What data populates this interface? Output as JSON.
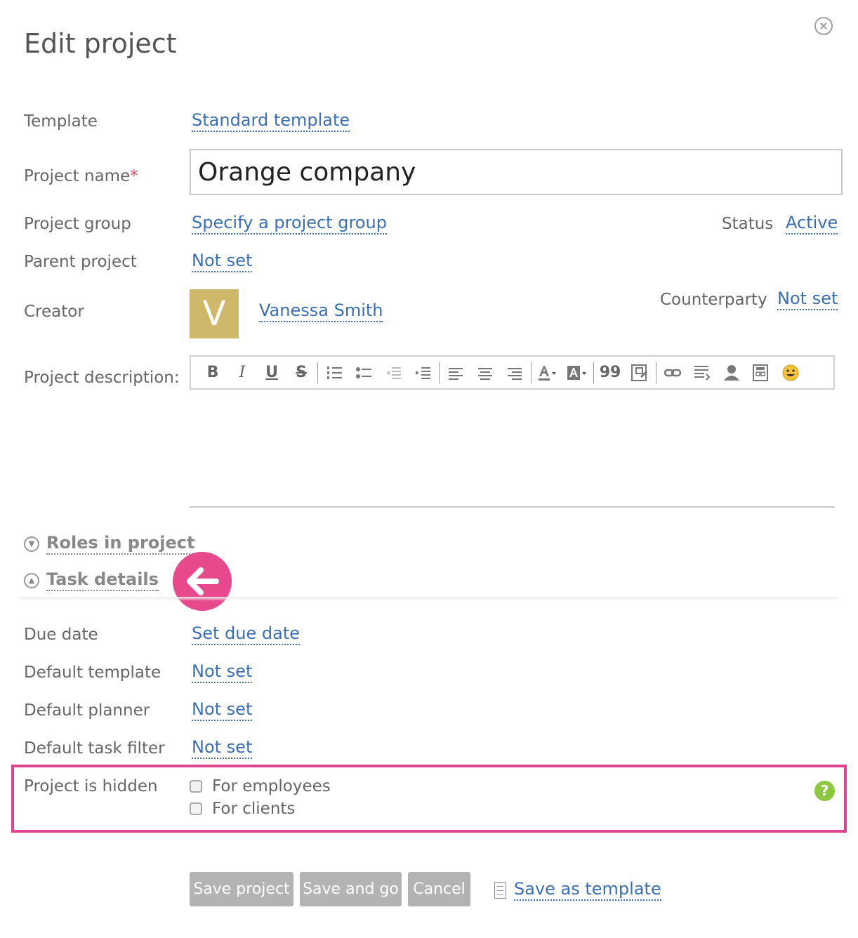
{
  "dialog": {
    "title": "Edit project"
  },
  "form": {
    "template_label": "Template",
    "template_value": "Standard template",
    "project_name_label": "Project name",
    "required_mark": "*",
    "project_name_value": "Orange company",
    "project_group_label": "Project group",
    "project_group_value": "Specify a project group",
    "status_label": "Status",
    "status_value": "Active",
    "parent_project_label": "Parent project",
    "parent_project_value": "Not set",
    "creator_label": "Creator",
    "creator_initial": "V",
    "creator_name": "Vanessa Smith",
    "counterparty_label": "Counterparty",
    "counterparty_value": "Not set",
    "description_label": "Project description:"
  },
  "toolbar": {
    "bold": "B",
    "italic": "I",
    "underline": "U",
    "strikethrough": "S",
    "quote": "99"
  },
  "sections": {
    "roles": "Roles in project",
    "task_details": "Task details"
  },
  "task_details": {
    "due_date_label": "Due date",
    "due_date_value": "Set due date",
    "default_template_label": "Default template",
    "default_template_value": "Not set",
    "default_planner_label": "Default planner",
    "default_planner_value": "Not set",
    "default_task_filter_label": "Default task filter",
    "default_task_filter_value": "Not set"
  },
  "hidden": {
    "label": "Project is hidden",
    "for_employees": "For employees",
    "for_clients": "For clients",
    "help": "?"
  },
  "actions": {
    "save_project": "Save project",
    "save_and_go": "Save and go",
    "cancel": "Cancel",
    "save_as_template": "Save as template"
  },
  "colors": {
    "link": "#3b6fb3",
    "highlight": "#e0448e",
    "avatar": "#d0b86a",
    "help": "#8dc63f",
    "button": "#b3b3b3"
  }
}
